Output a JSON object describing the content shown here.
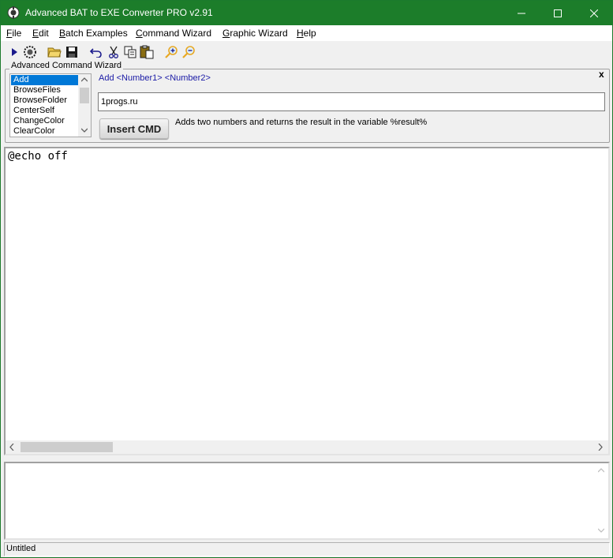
{
  "window": {
    "title": "Advanced BAT to EXE Converter PRO v2.91",
    "titlebar_color": "#1c7d2a"
  },
  "menu": {
    "items": [
      {
        "first": "F",
        "rest": "ile"
      },
      {
        "first": "E",
        "rest": "dit"
      },
      {
        "first": "B",
        "rest": "atch Examples"
      },
      {
        "first": "C",
        "rest": "ommand Wizard"
      },
      {
        "first": "G",
        "rest": "raphic Wizard"
      },
      {
        "first": "H",
        "rest": "elp"
      }
    ]
  },
  "toolbar": {
    "icons": [
      "run-icon",
      "compile-icon",
      "open-folder-icon",
      "save-icon",
      "undo-icon",
      "cut-icon",
      "copy-icon",
      "paste-icon",
      "zoom-in-icon",
      "zoom-out-icon"
    ]
  },
  "wizard": {
    "legend": "Advanced Command Wizard",
    "close": "x",
    "commands": [
      "Add",
      "BrowseFiles",
      "BrowseFolder",
      "CenterSelf",
      "ChangeColor",
      "ClearColor"
    ],
    "selected": "Add",
    "syntax": "Add  <Number1> <Number2>",
    "param_value": "1progs.ru",
    "insert_label": "Insert CMD",
    "description": "Adds two numbers and returns the result in the variable %result%"
  },
  "editor": {
    "content": "@echo off"
  },
  "status": {
    "filename": "Untitled"
  }
}
